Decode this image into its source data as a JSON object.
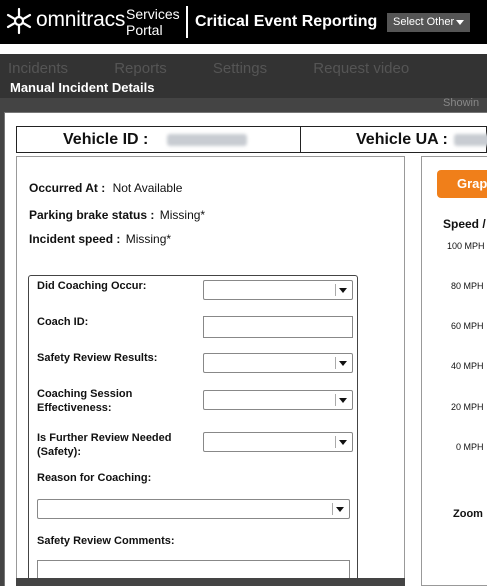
{
  "header": {
    "brand": "omnitracs",
    "services_line1": "Services",
    "services_line2": "Portal",
    "app_title": "Critical Event Reporting",
    "select_other": "Select Other"
  },
  "nav": {
    "items": [
      "Incidents",
      "Reports",
      "Settings",
      "Request video"
    ],
    "showing": "Showin"
  },
  "modal": {
    "title": "Manual Incident Details"
  },
  "vehicle": {
    "id_label": "Vehicle ID :",
    "ua_label": "Vehicle UA :"
  },
  "incident": {
    "occurred_at_label": "Occurred At :",
    "occurred_at_value": "Not Available",
    "parking_brake_label": "Parking brake status :",
    "parking_brake_value": "Missing*",
    "speed_label": "Incident speed :",
    "speed_value": "Missing*"
  },
  "coaching_form": {
    "did_coaching_occur": "Did Coaching Occur:",
    "coach_id": "Coach ID:",
    "safety_review_results": "Safety Review Results:",
    "coaching_session_effectiveness_1": "Coaching Session",
    "coaching_session_effectiveness_2": "Effectiveness:",
    "further_review_1": "Is Further Review Needed",
    "further_review_2": "(Safety):",
    "reason_for_coaching": "Reason for Coaching:",
    "safety_review_comments": "Safety Review Comments:"
  },
  "graph": {
    "button_label": "Grap",
    "speed_label": "Speed /",
    "ticks": [
      "100 MPH",
      "80 MPH",
      "60 MPH",
      "40 MPH",
      "20 MPH",
      "0 MPH"
    ],
    "zoom_label": "Zoom"
  },
  "colors": {
    "header_bg": "#000000",
    "accent_orange": "#f07f1a",
    "modal_bg": "#444444"
  }
}
